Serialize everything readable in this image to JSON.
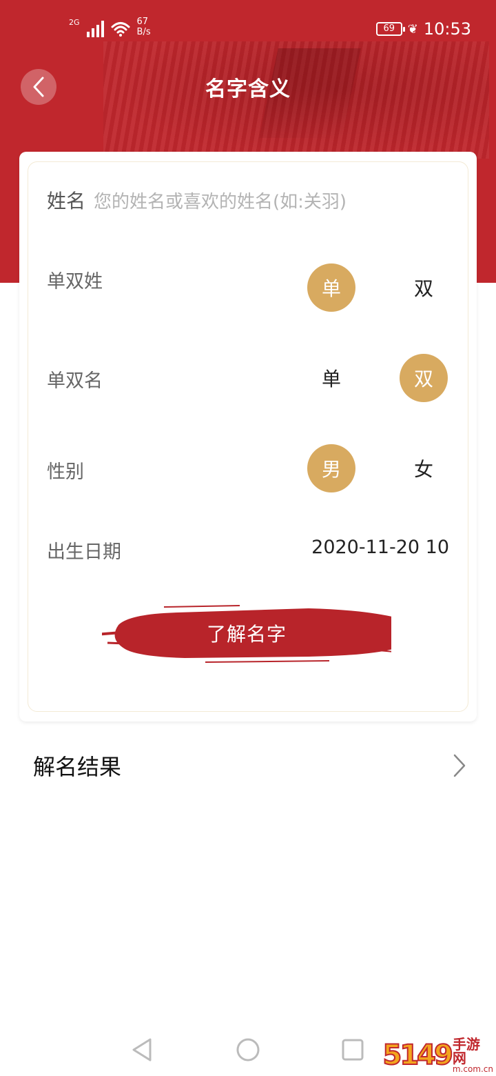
{
  "status_bar": {
    "network": "2G",
    "speed_value": "67",
    "speed_unit": "B/s",
    "battery": "69",
    "time": "10:53"
  },
  "header": {
    "title": "名字含义"
  },
  "form": {
    "name_label": "姓名",
    "name_placeholder": "您的姓名或喜欢的姓名(如:关羽)",
    "surname_label": "单双姓",
    "surname_options": [
      "单",
      "双"
    ],
    "surname_selected": "单",
    "given_label": "单双名",
    "given_options": [
      "单",
      "双"
    ],
    "given_selected": "双",
    "gender_label": "性别",
    "gender_options": [
      "男",
      "女"
    ],
    "gender_selected": "男",
    "birth_label": "出生日期",
    "birth_value": "2020-11-20 10",
    "submit_label": "了解名字"
  },
  "result": {
    "label": "解名结果"
  },
  "watermark": {
    "number": "5149",
    "brand": "手游网",
    "url": "m.com.cn"
  },
  "colors": {
    "brand_red": "#c0272d",
    "gold": "#d8aa60"
  }
}
